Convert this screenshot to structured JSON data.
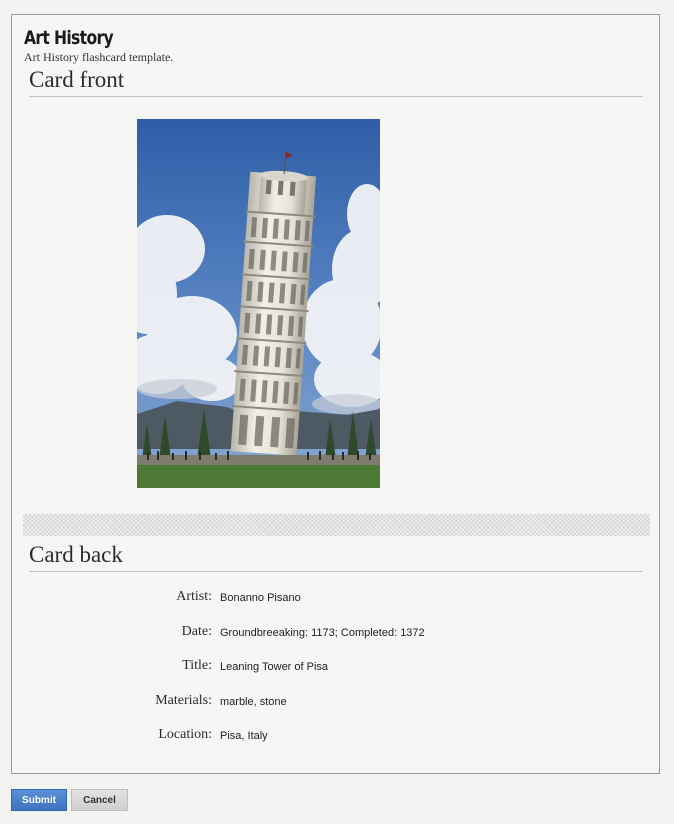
{
  "app": {
    "title": "Art History",
    "subtitle": "Art History flashcard template."
  },
  "card_front": {
    "heading": "Card front",
    "image": "leaning-tower-of-pisa-photo"
  },
  "card_back": {
    "heading": "Card back",
    "fields": [
      {
        "label": "Artist:",
        "value": "Bonanno Pisano"
      },
      {
        "label": "Date:",
        "value": "Groundbreeaking: 1173; Completed: 1372"
      },
      {
        "label": "Title:",
        "value": "Leaning Tower of Pisa"
      },
      {
        "label": "Materials:",
        "value": "marble, stone"
      },
      {
        "label": "Location:",
        "value": "Pisa, Italy"
      }
    ]
  },
  "actions": {
    "submit_label": "Submit",
    "cancel_label": "Cancel"
  },
  "colors": {
    "submit_button": "#4a7fcc",
    "sky": "#3d6cb5",
    "tower": "#ecebe3"
  }
}
